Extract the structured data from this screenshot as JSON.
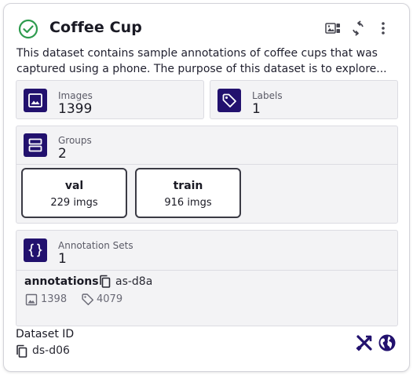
{
  "card": {
    "title": "Coffee Cup",
    "description": "This dataset contains sample annotations of coffee cups that was captured using a phone. The purpose of this dataset is to explore...",
    "header_icons": [
      "image-preview-icon",
      "sync-icon",
      "more-vert-icon"
    ],
    "status_icon": "check-circle-icon",
    "colors": {
      "accent": "#22116e",
      "status": "#2e9b4e",
      "panel": "#f3f3f5"
    }
  },
  "images": {
    "label": "Images",
    "value": "1399"
  },
  "labels": {
    "label": "Labels",
    "value": "1"
  },
  "groups": {
    "label": "Groups",
    "value": "2",
    "items": [
      {
        "name": "val",
        "count": "229 imgs"
      },
      {
        "name": "train",
        "count": "916 imgs"
      }
    ]
  },
  "annotation_sets": {
    "label": "Annotation Sets",
    "value": "1",
    "items": [
      {
        "name": "annotations",
        "id": "as-d8a",
        "images": "1398",
        "labels": "4079"
      }
    ]
  },
  "dataset": {
    "id_label": "Dataset ID",
    "id": "ds-d06",
    "footer_icons": [
      "annotate-tool-icon",
      "public-globe-icon"
    ]
  }
}
